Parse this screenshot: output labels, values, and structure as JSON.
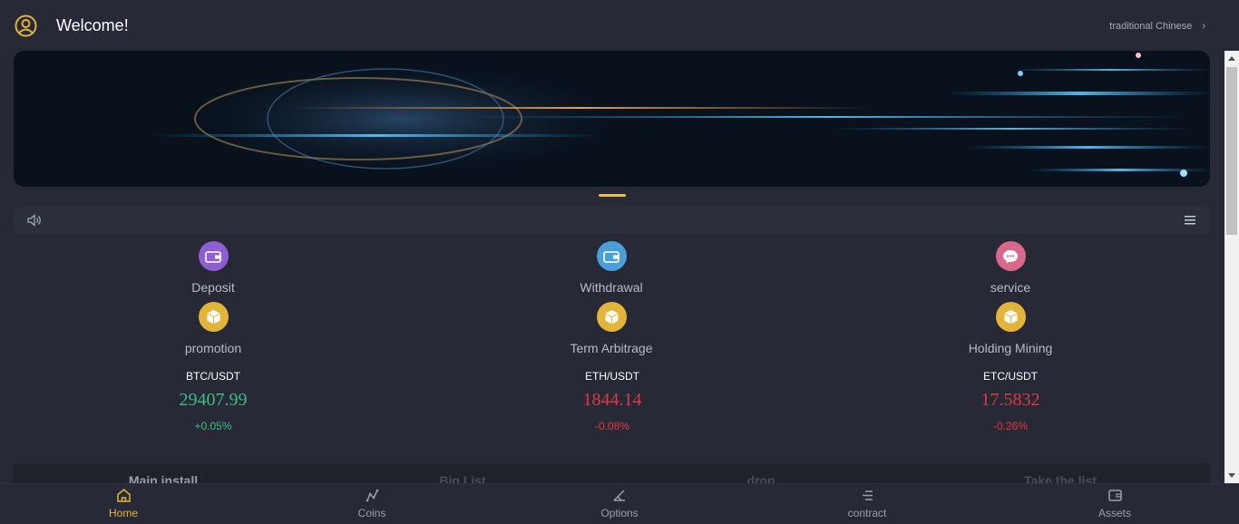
{
  "header": {
    "welcome": "Welcome!",
    "language": "traditional Chinese",
    "accent_color": "#e2b43a"
  },
  "banner": {
    "image": "bitcoin-banner"
  },
  "notice": {
    "speaker_icon": "speaker-icon",
    "menu_icon": "menu-icon"
  },
  "actions": [
    {
      "label": "Deposit",
      "icon": "wallet-icon",
      "color": "#8e5fd0"
    },
    {
      "label": "Withdrawal",
      "icon": "wallet-icon",
      "color": "#4a9fd8"
    },
    {
      "label": "service",
      "icon": "chat-icon",
      "color": "#d9698a"
    },
    {
      "label": "promotion",
      "icon": "box-icon",
      "color": "#e2b43a"
    },
    {
      "label": "Term Arbitrage",
      "icon": "box-icon",
      "color": "#e2b43a"
    },
    {
      "label": "Holding Mining",
      "icon": "box-icon",
      "color": "#e2b43a"
    }
  ],
  "tickers": [
    {
      "pair": "BTC/USDT",
      "price": "29407.99",
      "change": "+0.05%",
      "trend": "up"
    },
    {
      "pair": "ETH/USDT",
      "price": "1844.14",
      "change": "-0.08%",
      "trend": "down"
    },
    {
      "pair": "ETC/USDT",
      "price": "17.5832",
      "change": "-0.26%",
      "trend": "down"
    }
  ],
  "tabs": [
    "Main install",
    "Big List",
    "drop",
    "Take the list"
  ],
  "nav": [
    {
      "label": "Home",
      "icon": "home-icon",
      "active": true
    },
    {
      "label": "Coins",
      "icon": "coins-icon",
      "active": false
    },
    {
      "label": "Options",
      "icon": "options-icon",
      "active": false
    },
    {
      "label": "contract",
      "icon": "contract-icon",
      "active": false
    },
    {
      "label": "Assets",
      "icon": "wallet-icon",
      "active": false
    }
  ],
  "colors": {
    "up": "#3fbf7f",
    "down": "#e0393e",
    "background": "#272a36"
  }
}
